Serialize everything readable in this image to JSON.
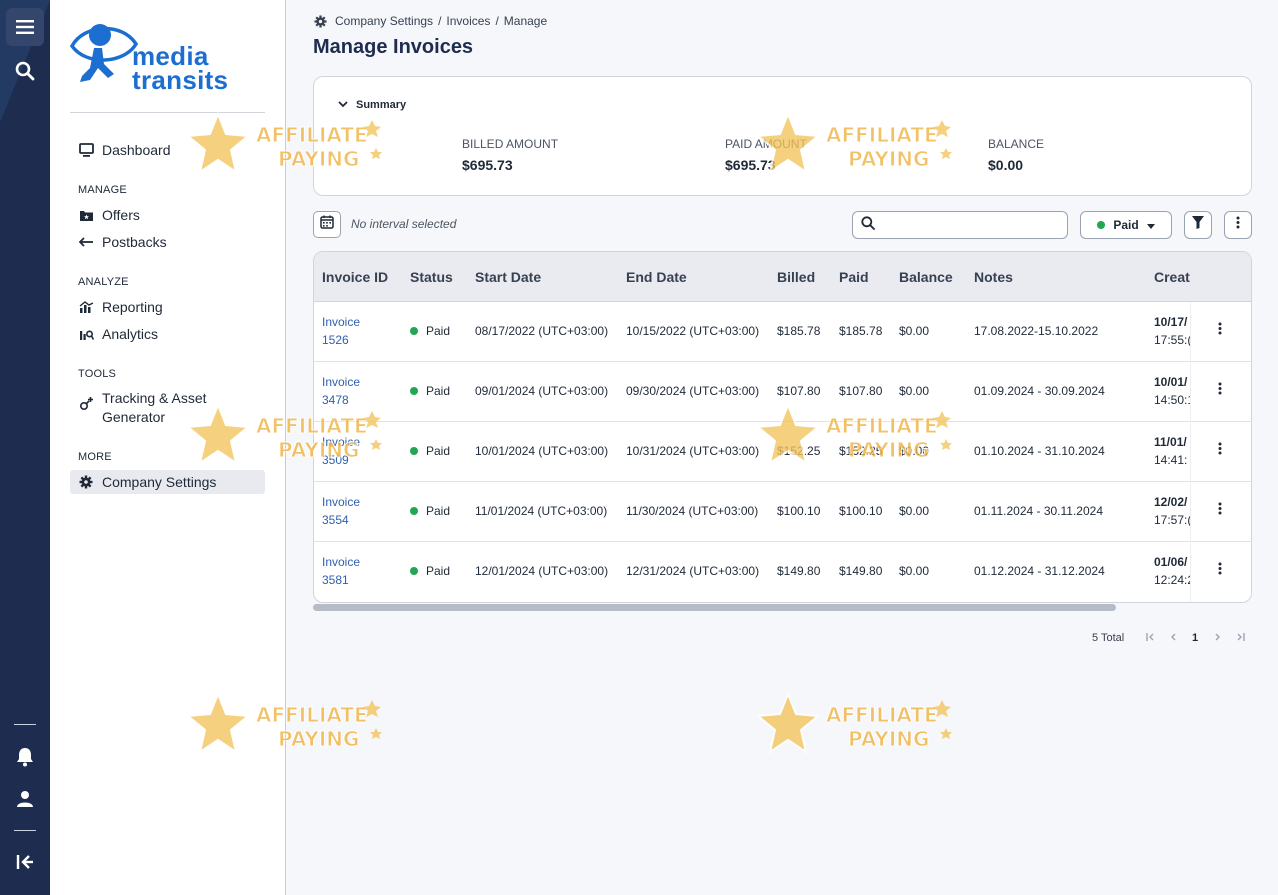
{
  "brand": {
    "name_line1": "media",
    "name_line2": "transits",
    "color": "#1c6fd1"
  },
  "rail": {
    "top_icons": [
      "menu-icon",
      "search-icon"
    ],
    "bottom_icons": [
      "bell-icon",
      "user-icon",
      "collapse-icon"
    ]
  },
  "sidebar": {
    "dashboard": "Dashboard",
    "sections": {
      "manage": "MANAGE",
      "analyze": "ANALYZE",
      "tools": "TOOLS",
      "more": "MORE"
    },
    "items": {
      "offers": "Offers",
      "postbacks": "Postbacks",
      "reporting": "Reporting",
      "analytics": "Analytics",
      "tracking_line1": "Tracking & Asset",
      "tracking_line2": "Generator",
      "company_settings": "Company Settings"
    }
  },
  "breadcrumb": {
    "items": [
      "Company Settings",
      "Invoices",
      "Manage"
    ],
    "separator": "/"
  },
  "page_title": "Manage Invoices",
  "summary": {
    "toggle_label": "Summary",
    "billed_label": "BILLED AMOUNT",
    "billed_value": "$695.73",
    "paid_label": "PAID AMOUNT",
    "paid_value": "$695.73",
    "balance_label": "BALANCE",
    "balance_value": "$0.00"
  },
  "toolbar": {
    "interval_text": "No interval selected",
    "search_placeholder": "",
    "status_filter_label": "Paid",
    "status_color": "#22a652"
  },
  "table": {
    "columns": [
      "Invoice ID",
      "Status",
      "Start Date",
      "End Date",
      "Billed",
      "Paid",
      "Balance",
      "Notes",
      "Create"
    ],
    "rows": [
      {
        "id_line1": "Invoice",
        "id_line2": "1526",
        "status": "Paid",
        "start": "08/17/2022 (UTC+03:00)",
        "end": "10/15/2022 (UTC+03:00)",
        "billed": "$185.78",
        "paid": "$185.78",
        "balance": "$0.00",
        "notes": "17.08.2022-15.10.2022",
        "created_line1": "10/17/",
        "created_line2": "17:55:("
      },
      {
        "id_line1": "Invoice",
        "id_line2": "3478",
        "status": "Paid",
        "start": "09/01/2024 (UTC+03:00)",
        "end": "09/30/2024 (UTC+03:00)",
        "billed": "$107.80",
        "paid": "$107.80",
        "balance": "$0.00",
        "notes": "01.09.2024 - 30.09.2024",
        "created_line1": "10/01/",
        "created_line2": "14:50:1"
      },
      {
        "id_line1": "Invoice",
        "id_line2": "3509",
        "status": "Paid",
        "start": "10/01/2024 (UTC+03:00)",
        "end": "10/31/2024 (UTC+03:00)",
        "billed": "$152.25",
        "paid": "$152.25",
        "balance": "$0.00",
        "notes": "01.10.2024 - 31.10.2024",
        "created_line1": "11/01/",
        "created_line2": "14:41:"
      },
      {
        "id_line1": "Invoice",
        "id_line2": "3554",
        "status": "Paid",
        "start": "11/01/2024 (UTC+03:00)",
        "end": "11/30/2024 (UTC+03:00)",
        "billed": "$100.10",
        "paid": "$100.10",
        "balance": "$0.00",
        "notes": "01.11.2024 - 30.11.2024",
        "created_line1": "12/02/",
        "created_line2": "17:57:("
      },
      {
        "id_line1": "Invoice",
        "id_line2": "3581",
        "status": "Paid",
        "start": "12/01/2024 (UTC+03:00)",
        "end": "12/31/2024 (UTC+03:00)",
        "billed": "$149.80",
        "paid": "$149.80",
        "balance": "$0.00",
        "notes": "01.12.2024 - 31.12.2024",
        "created_line1": "01/06/",
        "created_line2": "12:24:2"
      }
    ]
  },
  "pagination": {
    "total": "5 Total",
    "current_page": "1"
  },
  "watermark": {
    "line1": "AFFILIATE",
    "line2": "PAYING"
  }
}
